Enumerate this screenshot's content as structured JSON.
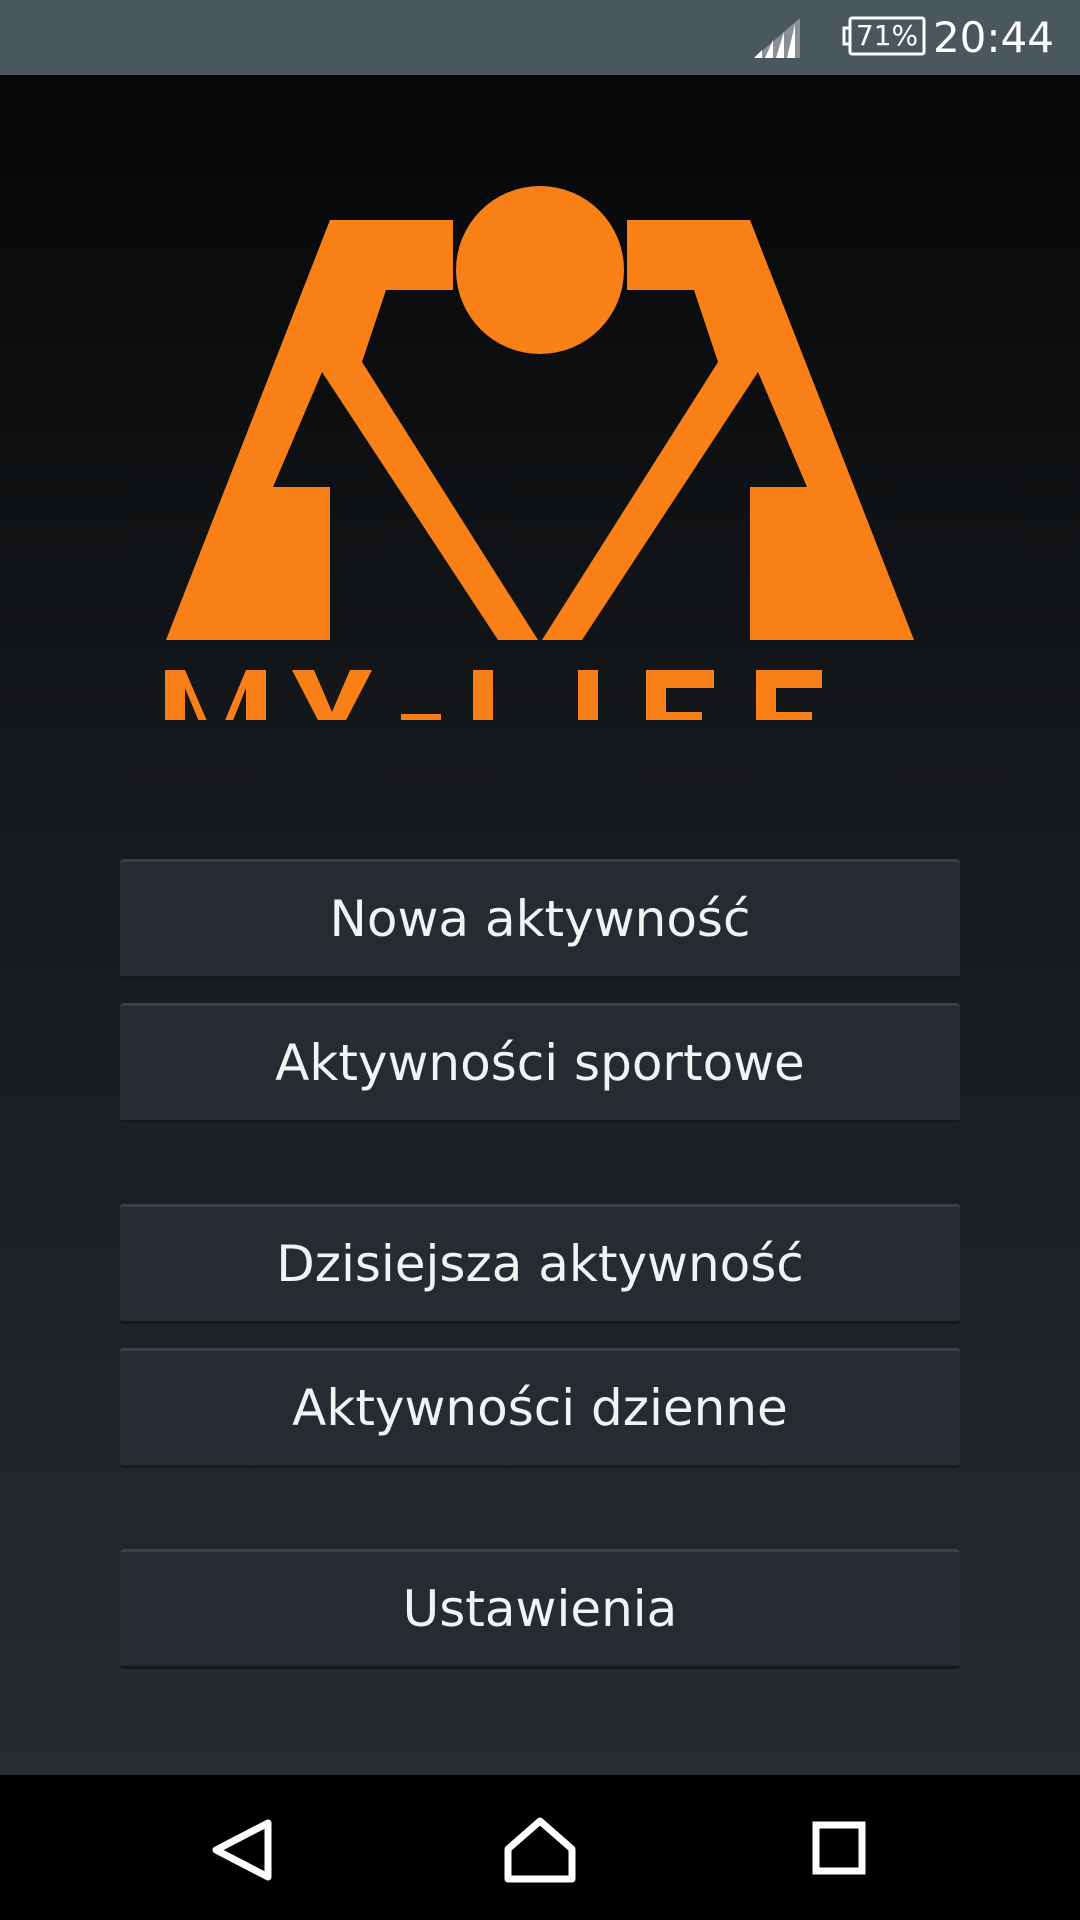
{
  "status_bar": {
    "battery": "71%",
    "time": "20:44",
    "icons": [
      "signal-icon",
      "battery-icon"
    ]
  },
  "logo": {
    "text": "MY-LIFE",
    "color": "#f98016"
  },
  "menu": {
    "new_activity": "Nowa aktywność",
    "sport_activities": "Aktywności sportowe",
    "today_activity": "Dzisiejsza aktywność",
    "daily_activities": "Aktywności dzienne",
    "settings": "Ustawienia"
  },
  "nav_bar": {
    "icons": [
      "back-icon",
      "home-icon",
      "recents-icon"
    ]
  }
}
